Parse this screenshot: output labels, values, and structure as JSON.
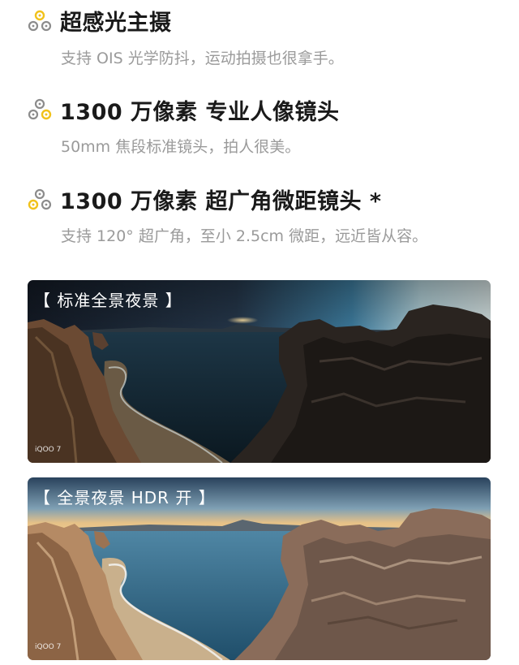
{
  "features": [
    {
      "icon": "triple-lens-icon",
      "title": "超感光主摄",
      "description": "支持 OIS 光学防抖，运动拍摄也很拿手。"
    },
    {
      "icon": "triple-lens-icon",
      "title": "1300 万像素 专业人像镜头",
      "description": "50mm 焦段标准镜头，拍人很美。"
    },
    {
      "icon": "triple-lens-icon",
      "title": "1300 万像素 超广角微距镜头 *",
      "description": "支持 120° 超广角，至小 2.5cm 微距，远近皆从容。"
    }
  ],
  "photos": [
    {
      "label": "【 标准全景夜景 】",
      "watermark": "iQOO 7"
    },
    {
      "label": "【 全景夜景 HDR 开 】",
      "watermark": "iQOO 7"
    }
  ],
  "colors": {
    "icon_yellow": "#f1c21b",
    "icon_gray": "#8c8c8c",
    "title": "#1a1a1a",
    "description": "#9a9a9a"
  }
}
